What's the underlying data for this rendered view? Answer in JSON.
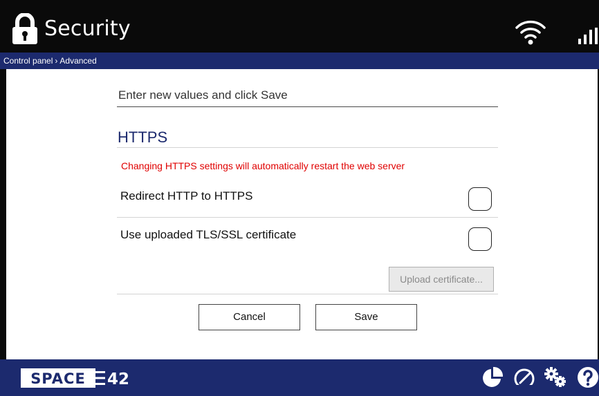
{
  "header": {
    "title": "Security",
    "icons": {
      "left": "lock-icon",
      "wifi": "wifi-icon",
      "signal": "signal-strength-icon"
    }
  },
  "breadcrumb": {
    "root": "Control panel",
    "separator": "›",
    "current": "Advanced"
  },
  "form": {
    "intro": "Enter new values and click Save",
    "section_title": "HTTPS",
    "warning": "Changing HTTPS settings will automatically restart the web server",
    "options": [
      {
        "label": "Redirect HTTP to HTTPS",
        "checked": false
      },
      {
        "label": "Use uploaded TLS/SSL certificate",
        "checked": false
      }
    ],
    "upload_button": "Upload certificate...",
    "cancel_button": "Cancel",
    "save_button": "Save"
  },
  "footer": {
    "logo": {
      "part1": "SPACE",
      "part2": "42"
    },
    "icons": [
      "pie-chart-icon",
      "speedometer-icon",
      "gears-icon",
      "help-icon"
    ]
  },
  "colors": {
    "topbar": "#0a0a0a",
    "navy": "#1c2a6e",
    "warning": "#e00000",
    "section_title": "#1c2a6e"
  }
}
